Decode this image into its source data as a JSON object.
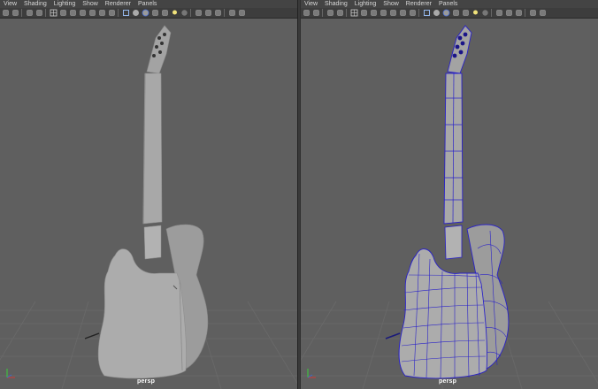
{
  "menus": [
    "View",
    "Shading",
    "Lighting",
    "Show",
    "Renderer",
    "Panels"
  ],
  "toolbar_icons": [
    "select-camera-icon",
    "camera-attributes-icon",
    "separator",
    "bookmark-icon",
    "image-plane-icon",
    "separator",
    "grid-icon",
    "film-gate-icon",
    "resolution-gate-icon",
    "gate-mask-icon",
    "field-chart-icon",
    "safe-action-icon",
    "safe-title-icon",
    "separator",
    "wireframe-icon",
    "smooth-shade-icon",
    "wireframe-on-shaded-icon",
    "use-default-material-icon",
    "textured-icon",
    "lights-icon",
    "shadows-icon",
    "separator",
    "screen-space-ao-icon",
    "motion-blur-icon",
    "anti-aliasing-icon",
    "separator",
    "isolate-select-icon",
    "xray-icon"
  ],
  "viewports": [
    {
      "camera": "persp",
      "shading": "smooth-shade",
      "wireframe_on_shaded": false
    },
    {
      "camera": "persp",
      "shading": "wireframe-on-shaded",
      "wireframe_on_shaded": true
    }
  ],
  "colors": {
    "viewport_bg": "#5f5f5f",
    "grid": "#6b6b6b",
    "model": "#a9a9a9",
    "wireframe": "#2a22c8",
    "menubar": "#444444"
  }
}
